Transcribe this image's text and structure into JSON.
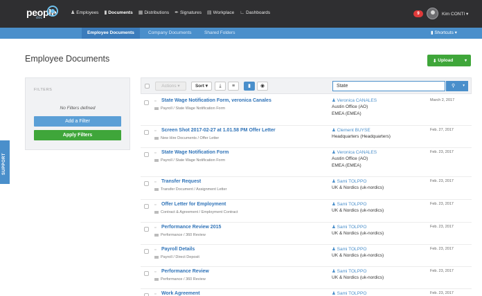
{
  "app": {
    "logo": "people",
    "logo_sub": "doc"
  },
  "nav": [
    {
      "label": "Employees",
      "icon": "people-icon",
      "active": false
    },
    {
      "label": "Documents",
      "icon": "document-icon",
      "active": true
    },
    {
      "label": "Distributions",
      "icon": "grid-icon",
      "active": false
    },
    {
      "label": "Signatures",
      "icon": "pen-icon",
      "active": false
    },
    {
      "label": "Workplace",
      "icon": "workplace-icon",
      "active": false
    },
    {
      "label": "Dashboards",
      "icon": "chart-icon",
      "active": false
    }
  ],
  "header": {
    "notification_count": "9",
    "username": "Kim CONTI"
  },
  "subnav": {
    "tabs": [
      {
        "label": "Employee Documents",
        "active": true
      },
      {
        "label": "Company Documents",
        "active": false
      },
      {
        "label": "Shared Folders",
        "active": false
      }
    ],
    "shortcuts": "Shortcuts"
  },
  "main": {
    "title": "Employee Documents",
    "upload_label": "Upload"
  },
  "filters": {
    "title": "FILTERS",
    "empty_text": "No Filters defined",
    "add_label": "Add a Filter",
    "apply_label": "Apply Filters"
  },
  "support_label": "SUPPORT",
  "toolbar": {
    "actions_label": "Actions",
    "sort_label": "Sort",
    "search_value": "State"
  },
  "documents": [
    {
      "title": "State Wage Notification Form, veronica Canales",
      "path": "Payroll / State Wage Notification Form",
      "employee": "Veronica CANALES",
      "lines": [
        "Austin Office (AO)",
        "EMEA (EMEA)"
      ],
      "date": "March 2, 2017"
    },
    {
      "title": "Screen Shot 2017-02-27 at 1.01.58 PM Offer Letter",
      "path": "New Hire Documents / Offer Letter",
      "employee": "Clement BUYSE",
      "lines": [
        "Headquarters (Headquarters)"
      ],
      "date": "Feb. 27, 2017"
    },
    {
      "title": "State Wage Notification Form",
      "path": "Payroll / State Wage Notification Form",
      "employee": "Veronica CANALES",
      "lines": [
        "Austin Office (AO)",
        "EMEA (EMEA)"
      ],
      "date": "Feb. 23, 2017"
    },
    {
      "title": "Transfer Request",
      "path": "Transfer Document / Assignment Letter",
      "employee": "Sami TOLPPO",
      "lines": [
        "UK & Nordics (uk-nordics)"
      ],
      "date": "Feb. 23, 2017"
    },
    {
      "title": "Offer Letter for Employment",
      "path": "Contract & Agreement / Employment Contract",
      "employee": "Sami TOLPPO",
      "lines": [
        "UK & Nordics (uk-nordics)"
      ],
      "date": "Feb. 23, 2017"
    },
    {
      "title": "Performance Review 2015",
      "path": "Performance / 360 Review",
      "employee": "Sami TOLPPO",
      "lines": [
        "UK & Nordics (uk-nordics)"
      ],
      "date": "Feb. 23, 2017"
    },
    {
      "title": "Payroll Details",
      "path": "Payroll / Direct Deposit",
      "employee": "Sami TOLPPO",
      "lines": [
        "UK & Nordics (uk-nordics)"
      ],
      "date": "Feb. 23, 2017"
    },
    {
      "title": "Performance Review",
      "path": "Performance / 360 Review",
      "employee": "Sami TOLPPO",
      "lines": [
        "UK & Nordics (uk-nordics)"
      ],
      "date": "Feb. 23, 2017"
    },
    {
      "title": "Work Agreement",
      "path": "",
      "employee": "Sami TOLPPO",
      "lines": [],
      "date": "Feb. 23, 2017"
    }
  ],
  "colors": {
    "topbar": "#2f2f31",
    "accent_blue": "#4a8fcb",
    "green": "#3fa63a",
    "link_blue": "#2f73b8",
    "badge_red": "#e03a3a"
  }
}
